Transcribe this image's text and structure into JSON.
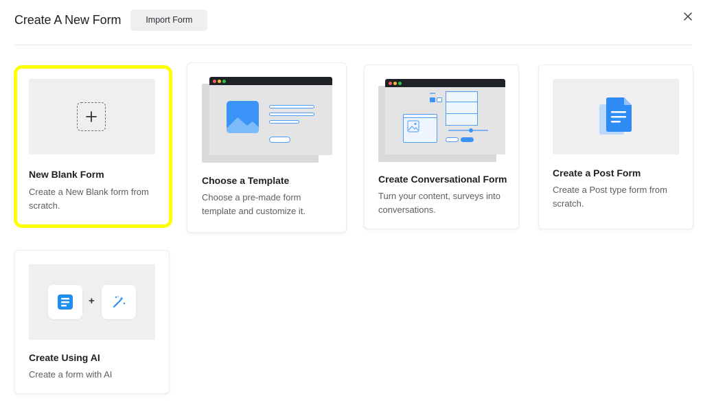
{
  "header": {
    "title": "Create A New Form",
    "import_label": "Import Form"
  },
  "cards": [
    {
      "title": "New Blank Form",
      "desc_line1": "Create a New Blank form from",
      "desc_line2": "scratch."
    },
    {
      "title": "Choose a Template",
      "desc_line1": "Choose a pre-made form",
      "desc_line2": "template and customize it."
    },
    {
      "title": "Create Conversational Form",
      "desc_line1": "Turn your content, surveys into",
      "desc_line2": "conversations."
    },
    {
      "title": "Create a Post Form",
      "desc_line1": "Create a Post type form from",
      "desc_line2": "scratch."
    },
    {
      "title": "Create Using AI",
      "desc_line1": "Create a form with AI",
      "desc_line2": ""
    }
  ],
  "ai_thumb": {
    "plus_symbol": "+"
  },
  "icons": {
    "close": "close-icon",
    "plus": "plus-icon",
    "image": "image-icon",
    "document": "document-icon",
    "form": "form-icon",
    "magic_wand": "magic-wand-icon"
  },
  "colors": {
    "highlight": "#ffff00",
    "accent_blue": "#2f8cf5",
    "card_thumb_bg": "#efefef",
    "title_text": "#1e1f21",
    "desc_text": "#5b5e63"
  }
}
